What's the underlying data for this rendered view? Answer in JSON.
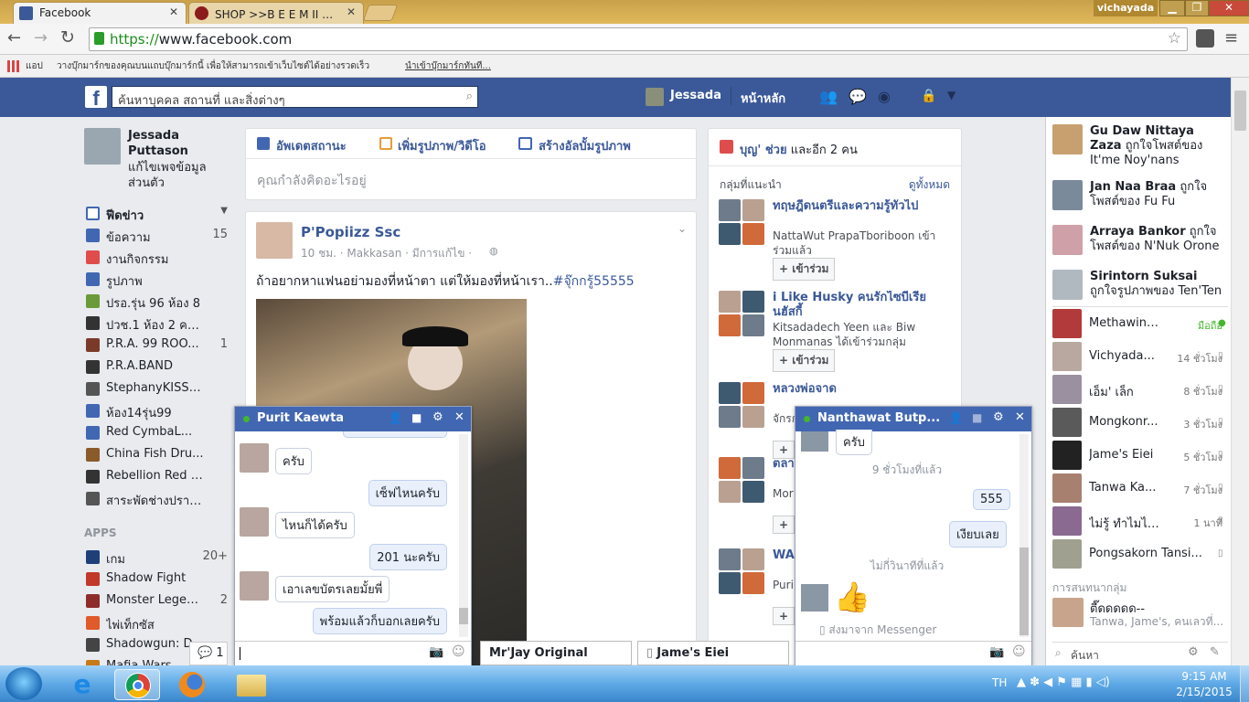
{
  "browser": {
    "tabs": [
      {
        "title": "Facebook"
      },
      {
        "title": "SHOP >>B E E M II Z<<[ช"
      }
    ],
    "window_user": "vichayada",
    "url_prefix": "https://",
    "url_host": "www.facebook.com",
    "bookmarks_apps": "แอป",
    "bookmarks_hint": "วางบุ๊กมาร์กของคุณบนแถบบุ๊กมาร์กนี้ เพื่อให้สามารถเข้าเว็บไซต์ได้อย่างรวดเร็ว",
    "bookmarks_link": "นำเข้าบุ๊กมาร์กทันที..."
  },
  "fb": {
    "search_placeholder": "ค้นหาบุคคล สถานที่ และสิ่งต่างๆ",
    "profile_name": "Jessada",
    "home": "หน้าหลัก"
  },
  "left": {
    "name": "Jessada Puttason",
    "edit": "แก้ไขเพจข้อมูลส่วนตัว",
    "items": [
      {
        "label": "ฟีดข่าว",
        "count": ""
      },
      {
        "label": "ข้อความ",
        "count": "15"
      },
      {
        "label": "งานกิจกรรม",
        "count": ""
      },
      {
        "label": "รูปภาพ",
        "count": ""
      },
      {
        "label": "ปรอ.รุ่น 96 ห้อง 8",
        "count": ""
      },
      {
        "label": "ปวช.1 ห้อง 2 คอม...",
        "count": ""
      },
      {
        "label": "P.R.A. 99 ROO...",
        "count": "1"
      },
      {
        "label": "P.R.A.BAND",
        "count": ""
      },
      {
        "label": "StephanyKISSY...",
        "count": ""
      },
      {
        "label": "ห้อง14รุ่น99",
        "count": ""
      },
      {
        "label": "Red CymbaL...",
        "count": ""
      },
      {
        "label": "China Fish Dru...",
        "count": ""
      },
      {
        "label": "Rebellion Red C...",
        "count": ""
      },
      {
        "label": "สาระพัดช่างปราจี...",
        "count": ""
      }
    ],
    "apps_header": "APPS",
    "apps": [
      {
        "label": "เกม",
        "count": "20+"
      },
      {
        "label": "Shadow Fight",
        "count": ""
      },
      {
        "label": "Monster Legends",
        "count": "2"
      },
      {
        "label": "ไพ่เท็กซัส",
        "count": ""
      },
      {
        "label": "Shadowgun: D...",
        "count": ""
      },
      {
        "label": "Mafia Wars",
        "count": ""
      }
    ]
  },
  "composer": {
    "tab_status": "อัพเดตสถานะ",
    "tab_photo": "เพิ่มรูปภาพ/วิดีโอ",
    "tab_album": "สร้างอัลบั้มรูปภาพ",
    "placeholder": "คุณกำลังคิดอะไรอยู่"
  },
  "post": {
    "author": "P'Popiizz Ssc",
    "meta": "10 ชม. · Makkasan · มีการแก้ไข ·",
    "text": "ถ้าอยากหาแฟนอย่ามองที่หน้าตา แต่ให้มองที่หน้าเรา..",
    "hashtag": "#จุ๊กกรู้55555"
  },
  "groups": {
    "birthday_name": "บุญ' ช่วย",
    "birthday_rest": "และอีก 2 คน",
    "suggest_title": "กลุ่มที่แนะนำ",
    "see_all": "ดูทั้งหมด",
    "list": [
      {
        "name": "ทฤษฎีดนตรีและความรู้ทั่วไป",
        "desc": "NattaWut PrapaTboriboon เข้าร่วมแล้ว",
        "join": "+ เข้าร่วม"
      },
      {
        "name": "i Like Husky คนรักไซบีเรียนฮัสกี้",
        "desc": "Kitsadadech Yeen และ Biw Monmanas ได้เข้าร่วมกลุ่ม",
        "join": "+ เข้าร่วม"
      },
      {
        "name": "หลวงพ่อจาด",
        "desc": "จักรกฤษณ์ ฉ้ำล้ำ และ Felling Dst",
        "join": "+"
      },
      {
        "name": "ตลา Infe แท้)",
        "desc": "Mor",
        "join": "+"
      },
      {
        "name": "WA BUY SAF",
        "desc": "Puri Yee",
        "join": "+"
      }
    ]
  },
  "ticker": [
    {
      "name": "Gu Daw Nittaya Zaza",
      "text": "ถูกใจโพสต์ของ It'me Noy'nans"
    },
    {
      "name": "Jan Naa Braa",
      "text": "ถูกใจโพสต์ของ Fu Fu"
    },
    {
      "name": "Arraya Bankor",
      "text": "ถูกใจโพสต์ของ N'Nuk Orone"
    },
    {
      "name": "Sirintorn Suksai",
      "text": "ถูกใจรูปภาพของ Ten'Ten"
    }
  ],
  "chat_list": [
    {
      "name": "Methawin Api...",
      "time": "มือถือ"
    },
    {
      "name": "Vichyada...",
      "time": "14 ชั่วโมง"
    },
    {
      "name": "เอ็ม' เล็ก",
      "time": "8 ชั่วโมง"
    },
    {
      "name": "Mongkonr...",
      "time": "3 ชั่วโมง"
    },
    {
      "name": "Jame's Eiei",
      "time": "5 ชั่วโมง"
    },
    {
      "name": "Tanwa Ka...",
      "time": "7 ชั่วโมง"
    },
    {
      "name": "ไม่รู้ ทำไมไม่ถ...",
      "time": "1 นาที"
    },
    {
      "name": "Pongsakorn Tansi...",
      "time": ""
    }
  ],
  "group_convo": {
    "title": "การสนทนากลุ่ม",
    "name": "ตี๊ดดดดด--",
    "members": "Tanwa, Jame's, คนเลวที่..."
  },
  "chat_search": "ค้นหา",
  "chat1": {
    "name": "Purit Kaewta",
    "messages": [
      {
        "side": "left",
        "text": "ครับ"
      },
      {
        "side": "right",
        "text": "เซ็ฟไหนครับ"
      },
      {
        "side": "left",
        "text": "ไหนก็ได้ครับ"
      },
      {
        "side": "right",
        "text": "201 นะครับ"
      },
      {
        "side": "left",
        "text": "เอาเลขบัตรเลยมั้ยพี่"
      },
      {
        "side": "right",
        "text": "พร้อมแล้วก็บอกเลยครับ"
      }
    ]
  },
  "chat2": {
    "name": "Nanthawat Butp...",
    "top": "ครับ",
    "sep1": "9 ชั่วโมงที่แล้ว",
    "m1": "555",
    "m2": "เงียบเลย",
    "sep2": "ไม่กี่วินาทีที่แล้ว",
    "footer": "ส่งมาจาก Messenger"
  },
  "minimized": [
    {
      "name": "Mr'Jay Original"
    },
    {
      "name": "Jame's Eiei"
    }
  ],
  "unread_count": "1",
  "taskbar": {
    "lang": "TH",
    "time": "9:15 AM",
    "date": "2/15/2015"
  },
  "colors": {
    "fb_blue": "#3b5998",
    "chat_head": "#4267b2",
    "online": "#42b72a"
  }
}
